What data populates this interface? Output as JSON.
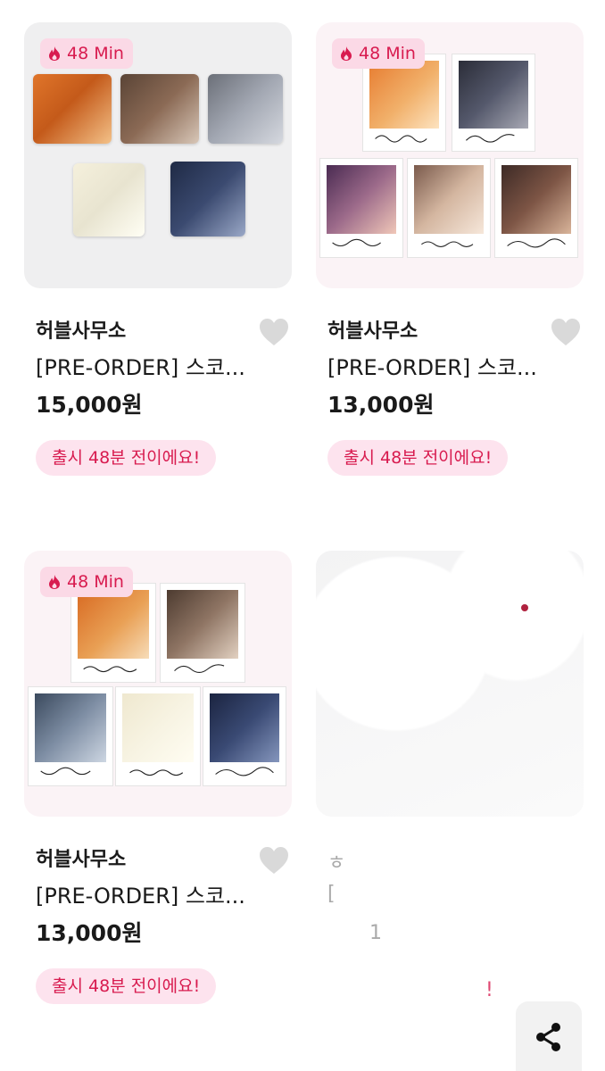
{
  "products": [
    {
      "timer": "48 Min",
      "brand": "허블사무소",
      "title": "[PRE-ORDER] 스코...",
      "price": "15,000원",
      "release_badge": "출시 48분 전이에요!"
    },
    {
      "timer": "48 Min",
      "brand": "허블사무소",
      "title": "[PRE-ORDER] 스코...",
      "price": "13,000원",
      "release_badge": "출시 48분 전이에요!"
    },
    {
      "timer": "48 Min",
      "brand": "허블사무소",
      "title": "[PRE-ORDER] 스코...",
      "price": "13,000원",
      "release_badge": "출시 48분 전이에요!"
    },
    {
      "brand": "ㅎ",
      "title": "[",
      "price": "1",
      "release_badge": "!"
    }
  ],
  "icons": {
    "timer": "fire-icon",
    "like": "heart-icon",
    "share": "share-icon"
  },
  "colors": {
    "accent": "#d81b4f",
    "badge_bg": "#fde3ee",
    "timer_bg": "#fbd9e6",
    "heart": "#d9d9d9"
  }
}
